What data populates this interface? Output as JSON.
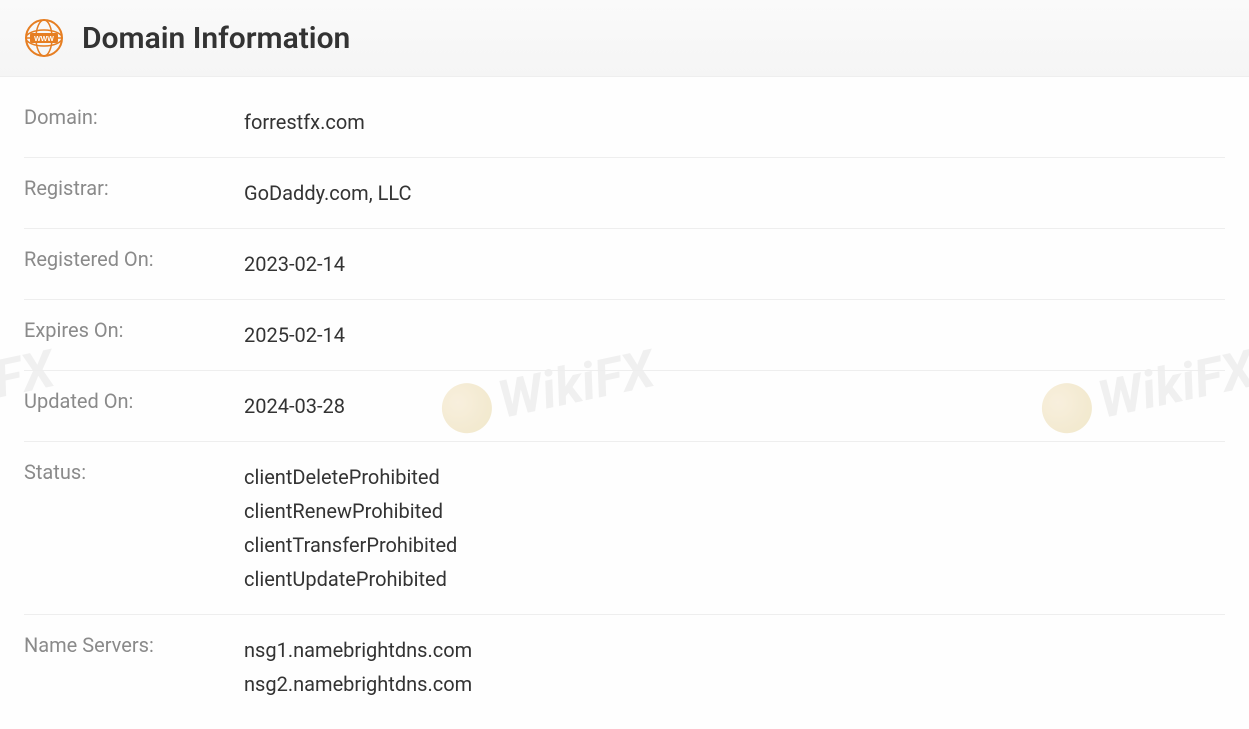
{
  "header": {
    "title": "Domain Information"
  },
  "rows": {
    "domain": {
      "label": "Domain:",
      "value": "forrestfx.com"
    },
    "registrar": {
      "label": "Registrar:",
      "value": "GoDaddy.com, LLC"
    },
    "registered_on": {
      "label": "Registered On:",
      "value": "2023-02-14"
    },
    "expires_on": {
      "label": "Expires On:",
      "value": "2025-02-14"
    },
    "updated_on": {
      "label": "Updated On:",
      "value": "2024-03-28"
    },
    "status": {
      "label": "Status:",
      "values": [
        "clientDeleteProhibited",
        "clientRenewProhibited",
        "clientTransferProhibited",
        "clientUpdateProhibited"
      ]
    },
    "name_servers": {
      "label": "Name Servers:",
      "values": [
        "nsg1.namebrightdns.com",
        "nsg2.namebrightdns.com"
      ]
    }
  },
  "watermark": {
    "text": "WikiFX"
  }
}
